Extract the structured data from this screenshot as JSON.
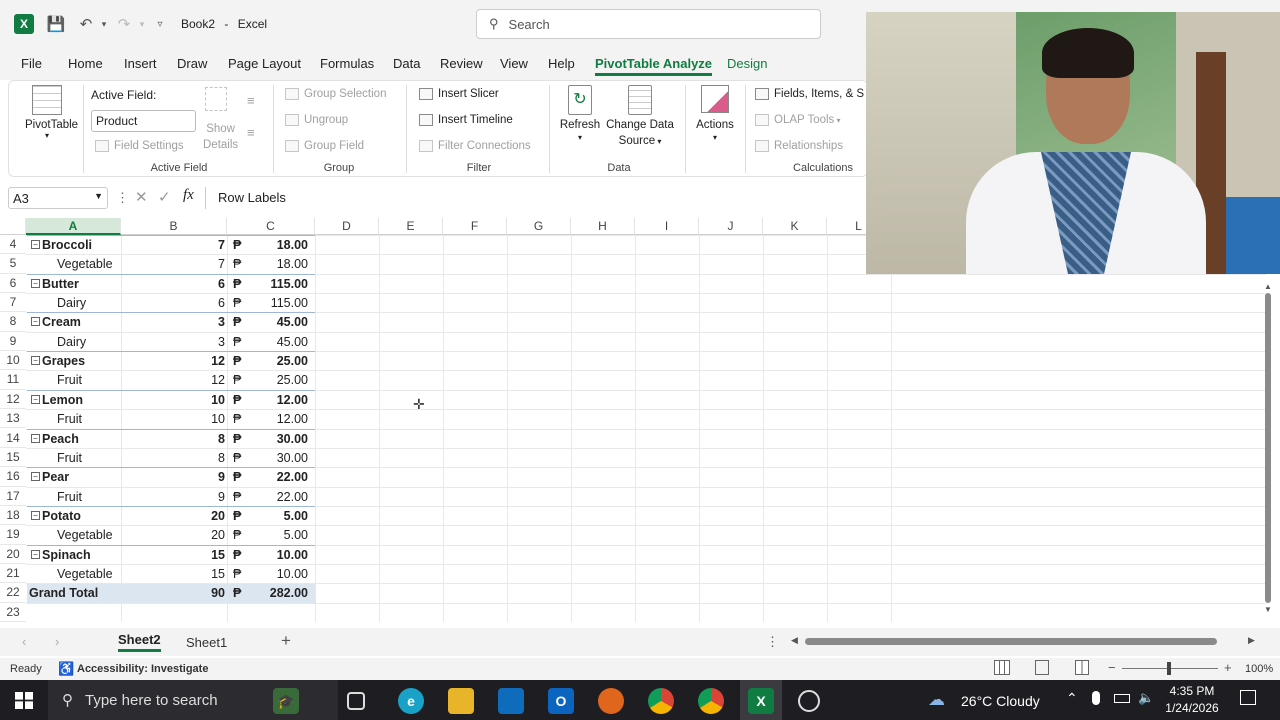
{
  "titlebar": {
    "doc_title": "Book2",
    "sep": "-",
    "app_name": "Excel",
    "search_placeholder": "Search"
  },
  "menu": [
    "File",
    "Home",
    "Insert",
    "Draw",
    "Page Layout",
    "Formulas",
    "Data",
    "Review",
    "View",
    "Help",
    "PivotTable Analyze",
    "Design"
  ],
  "ribbon": {
    "pivottable": "PivotTable",
    "active_field_label": "Active Field:",
    "active_field_value": "Product",
    "show_details": "Show",
    "show_details2": "Details",
    "field_settings": "Field Settings",
    "group_active_field": "Active Field",
    "group_selection": "Group Selection",
    "ungroup": "Ungroup",
    "group_field": "Group Field",
    "group_group": "Group",
    "insert_slicer": "Insert Slicer",
    "insert_timeline": "Insert Timeline",
    "filter_connections": "Filter Connections",
    "group_filter": "Filter",
    "refresh": "Refresh",
    "change_data": "Change Data",
    "source": "Source",
    "group_data": "Data",
    "actions": "Actions",
    "fields_items": "Fields, Items, & S",
    "olap_tools": "OLAP Tools",
    "relationships": "Relationships",
    "group_calculations": "Calculations"
  },
  "formula_bar": {
    "name_box": "A3",
    "fx": "fx",
    "content": "Row Labels"
  },
  "columns": [
    "A",
    "B",
    "C",
    "D",
    "E",
    "F",
    "G",
    "H",
    "I",
    "J",
    "K",
    "L"
  ],
  "rows": [
    {
      "n": "4",
      "label": "Broccoli",
      "type": "group",
      "qty": "7",
      "peso": "₱",
      "amt": "18.00"
    },
    {
      "n": "5",
      "label": "Vegetable",
      "type": "item",
      "qty": "7",
      "peso": "₱",
      "amt": "18.00"
    },
    {
      "n": "6",
      "label": "Butter",
      "type": "group",
      "qty": "6",
      "peso": "₱",
      "amt": "115.00"
    },
    {
      "n": "7",
      "label": "Dairy",
      "type": "item",
      "qty": "6",
      "peso": "₱",
      "amt": "115.00"
    },
    {
      "n": "8",
      "label": "Cream",
      "type": "group",
      "qty": "3",
      "peso": "₱",
      "amt": "45.00"
    },
    {
      "n": "9",
      "label": "Dairy",
      "type": "item",
      "qty": "3",
      "peso": "₱",
      "amt": "45.00"
    },
    {
      "n": "10",
      "label": "Grapes",
      "type": "group",
      "qty": "12",
      "peso": "₱",
      "amt": "25.00"
    },
    {
      "n": "11",
      "label": "Fruit",
      "type": "item",
      "qty": "12",
      "peso": "₱",
      "amt": "25.00"
    },
    {
      "n": "12",
      "label": "Lemon",
      "type": "group",
      "qty": "10",
      "peso": "₱",
      "amt": "12.00"
    },
    {
      "n": "13",
      "label": "Fruit",
      "type": "item",
      "qty": "10",
      "peso": "₱",
      "amt": "12.00"
    },
    {
      "n": "14",
      "label": "Peach",
      "type": "group",
      "qty": "8",
      "peso": "₱",
      "amt": "30.00"
    },
    {
      "n": "15",
      "label": "Fruit",
      "type": "item",
      "qty": "8",
      "peso": "₱",
      "amt": "30.00"
    },
    {
      "n": "16",
      "label": "Pear",
      "type": "group",
      "qty": "9",
      "peso": "₱",
      "amt": "22.00"
    },
    {
      "n": "17",
      "label": "Fruit",
      "type": "item",
      "qty": "9",
      "peso": "₱",
      "amt": "22.00"
    },
    {
      "n": "18",
      "label": "Potato",
      "type": "group",
      "qty": "20",
      "peso": "₱",
      "amt": "5.00"
    },
    {
      "n": "19",
      "label": "Vegetable",
      "type": "item",
      "qty": "20",
      "peso": "₱",
      "amt": "5.00"
    },
    {
      "n": "20",
      "label": "Spinach",
      "type": "group",
      "qty": "15",
      "peso": "₱",
      "amt": "10.00"
    },
    {
      "n": "21",
      "label": "Vegetable",
      "type": "item",
      "qty": "15",
      "peso": "₱",
      "amt": "10.00"
    },
    {
      "n": "22",
      "label": "Grand Total",
      "type": "total",
      "qty": "90",
      "peso": "₱",
      "amt": "282.00"
    },
    {
      "n": "23",
      "label": "",
      "type": "empty",
      "qty": "",
      "peso": "",
      "amt": ""
    }
  ],
  "sheets": {
    "active": "Sheet2",
    "other": "Sheet1",
    "add": "+"
  },
  "status": {
    "ready": "Ready",
    "accessibility": "Accessibility: Investigate",
    "zoom": "100%"
  },
  "taskbar": {
    "search_placeholder": "Type here to search",
    "weather": "26°C  Cloudy",
    "time": "4:35 PM",
    "date": "1/24/2026"
  },
  "colors": {
    "accent": "#107c41",
    "total_bg": "#dce6f1"
  }
}
